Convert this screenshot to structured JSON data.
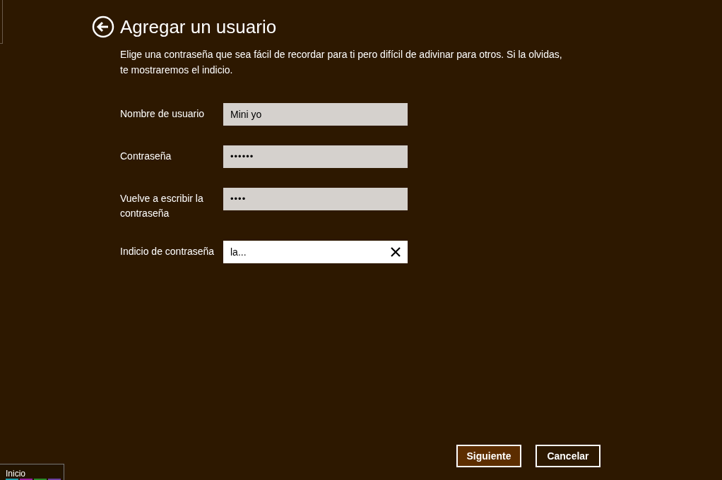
{
  "page": {
    "title": "Agregar un usuario",
    "description": "Elige una contraseña que sea fácil de recordar para ti pero difícil de adivinar para otros. Si la olvidas, te mostraremos el indicio."
  },
  "fields": [
    {
      "kind": "text",
      "label": "Nombre de usuario",
      "value": "Mini yo",
      "focused": false
    },
    {
      "kind": "password",
      "label": "Contraseña",
      "value": "••••••",
      "focused": false
    },
    {
      "kind": "password",
      "label": "Vuelve a escribir la contraseña",
      "value": "••••",
      "focused": false
    },
    {
      "kind": "text",
      "label": "Indicio de contraseña",
      "value": "la...",
      "focused": true
    }
  ],
  "buttons": [
    {
      "label": "Siguiente",
      "primary": true
    },
    {
      "label": "Cancelar",
      "primary": false
    }
  ],
  "start_tip": {
    "label": "Inicio"
  }
}
